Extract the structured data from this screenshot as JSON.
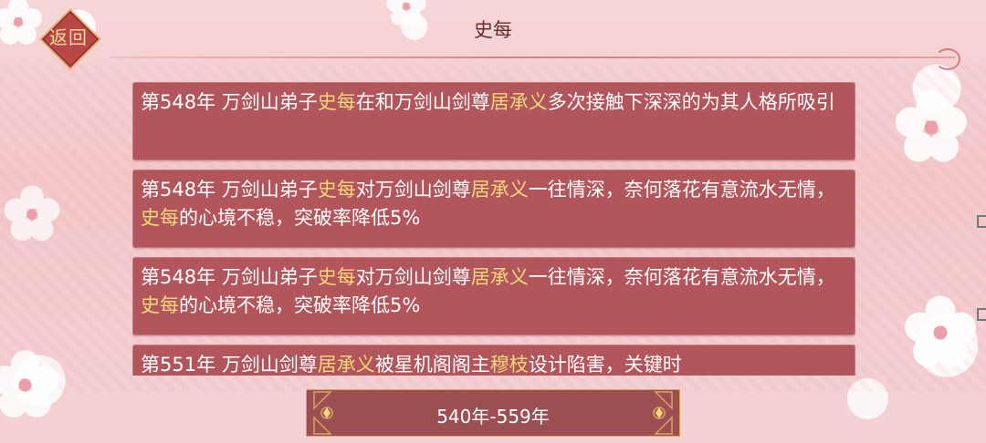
{
  "header": {
    "back_label": "返回",
    "title": "史每"
  },
  "events": [
    {
      "segments": [
        {
          "text": "第548年 万剑山弟子",
          "hl": false
        },
        {
          "text": "史每",
          "hl": true
        },
        {
          "text": "在和万剑山剑尊",
          "hl": false
        },
        {
          "text": "居承义",
          "hl": true
        },
        {
          "text": "多次接触下深深的为其人格所吸引",
          "hl": false
        }
      ]
    },
    {
      "segments": [
        {
          "text": "第548年 万剑山弟子",
          "hl": false
        },
        {
          "text": "史每",
          "hl": true
        },
        {
          "text": "对万剑山剑尊",
          "hl": false
        },
        {
          "text": "居承义",
          "hl": true
        },
        {
          "text": "一往情深，奈何落花有意流水无情，",
          "hl": false
        },
        {
          "text": "史每",
          "hl": true
        },
        {
          "text": "的心境不稳，突破率降低5%",
          "hl": false
        }
      ]
    },
    {
      "segments": [
        {
          "text": "第548年 万剑山弟子",
          "hl": false
        },
        {
          "text": "史每",
          "hl": true
        },
        {
          "text": "对万剑山剑尊",
          "hl": false
        },
        {
          "text": "居承义",
          "hl": true
        },
        {
          "text": "一往情深，奈何落花有意流水无情，",
          "hl": false
        },
        {
          "text": "史每",
          "hl": true
        },
        {
          "text": "的心境不稳，突破率降低5%",
          "hl": false
        }
      ]
    },
    {
      "segments": [
        {
          "text": "第551年 万剑山剑尊",
          "hl": false
        },
        {
          "text": "居承义",
          "hl": true
        },
        {
          "text": "被星机阁阁主",
          "hl": false
        },
        {
          "text": "穆枝",
          "hl": true
        },
        {
          "text": "设计陷害，关键时",
          "hl": false
        }
      ]
    }
  ],
  "range": {
    "label": "540年-559年"
  },
  "colors": {
    "panel": "#a8464c",
    "highlight": "#f6d97a",
    "title": "#6b2c2c",
    "gold": "#e7b46a"
  },
  "icons": {
    "back": "diamond-frame",
    "range_left": "cloud-ornament-left",
    "range_right": "cloud-ornament-right"
  }
}
